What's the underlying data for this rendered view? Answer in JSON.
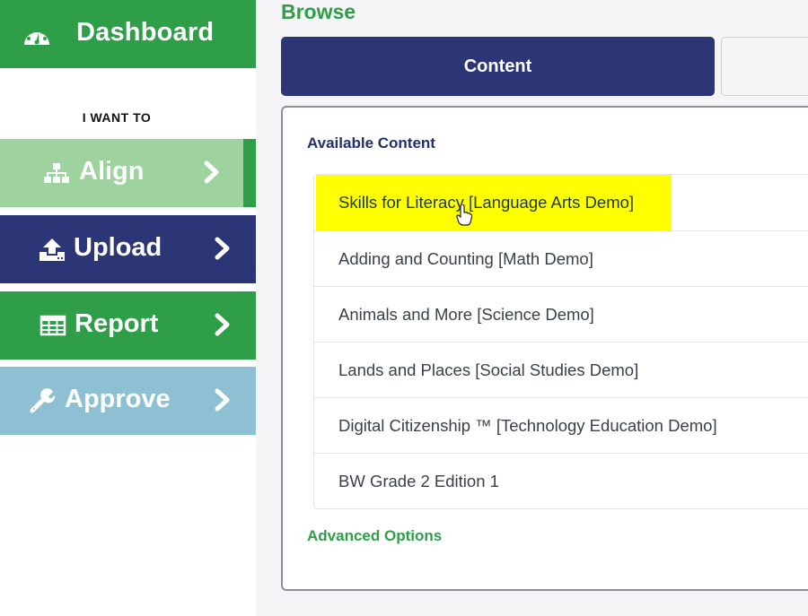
{
  "sidebar": {
    "dashboard": {
      "label": "Dashboard",
      "icon": "tachometer-icon"
    },
    "section_heading": "I WANT TO",
    "items": [
      {
        "label": "Align",
        "icon": "sitemap-icon",
        "color": "#9ed29f",
        "active": true
      },
      {
        "label": "Upload",
        "icon": "upload-icon",
        "color": "#2c3677"
      },
      {
        "label": "Report",
        "icon": "table-icon",
        "color": "#2e9e48"
      },
      {
        "label": "Approve",
        "icon": "wrench-icon",
        "color": "#8ec0d4"
      }
    ]
  },
  "main": {
    "title": "Browse",
    "tabs": [
      {
        "label": "Content",
        "active": true
      },
      {
        "label": ""
      }
    ],
    "panel": {
      "heading": "Available Content",
      "items": [
        {
          "label": "Skills for Literacy [Language Arts Demo]",
          "highlighted": true
        },
        {
          "label": "Adding and Counting [Math Demo]"
        },
        {
          "label": "Animals and More [Science Demo]"
        },
        {
          "label": "Lands and Places [Social Studies Demo]"
        },
        {
          "label": "Digital Citizenship ™ [Technology Education Demo]"
        },
        {
          "label": "BW Grade 2 Edition 1"
        }
      ],
      "advanced_link": "Advanced Options"
    }
  },
  "colors": {
    "green": "#2e9e48",
    "navy": "#2c3677",
    "light_green": "#9ed29f",
    "light_blue": "#8ec0d4",
    "highlight": "#ffff00"
  }
}
